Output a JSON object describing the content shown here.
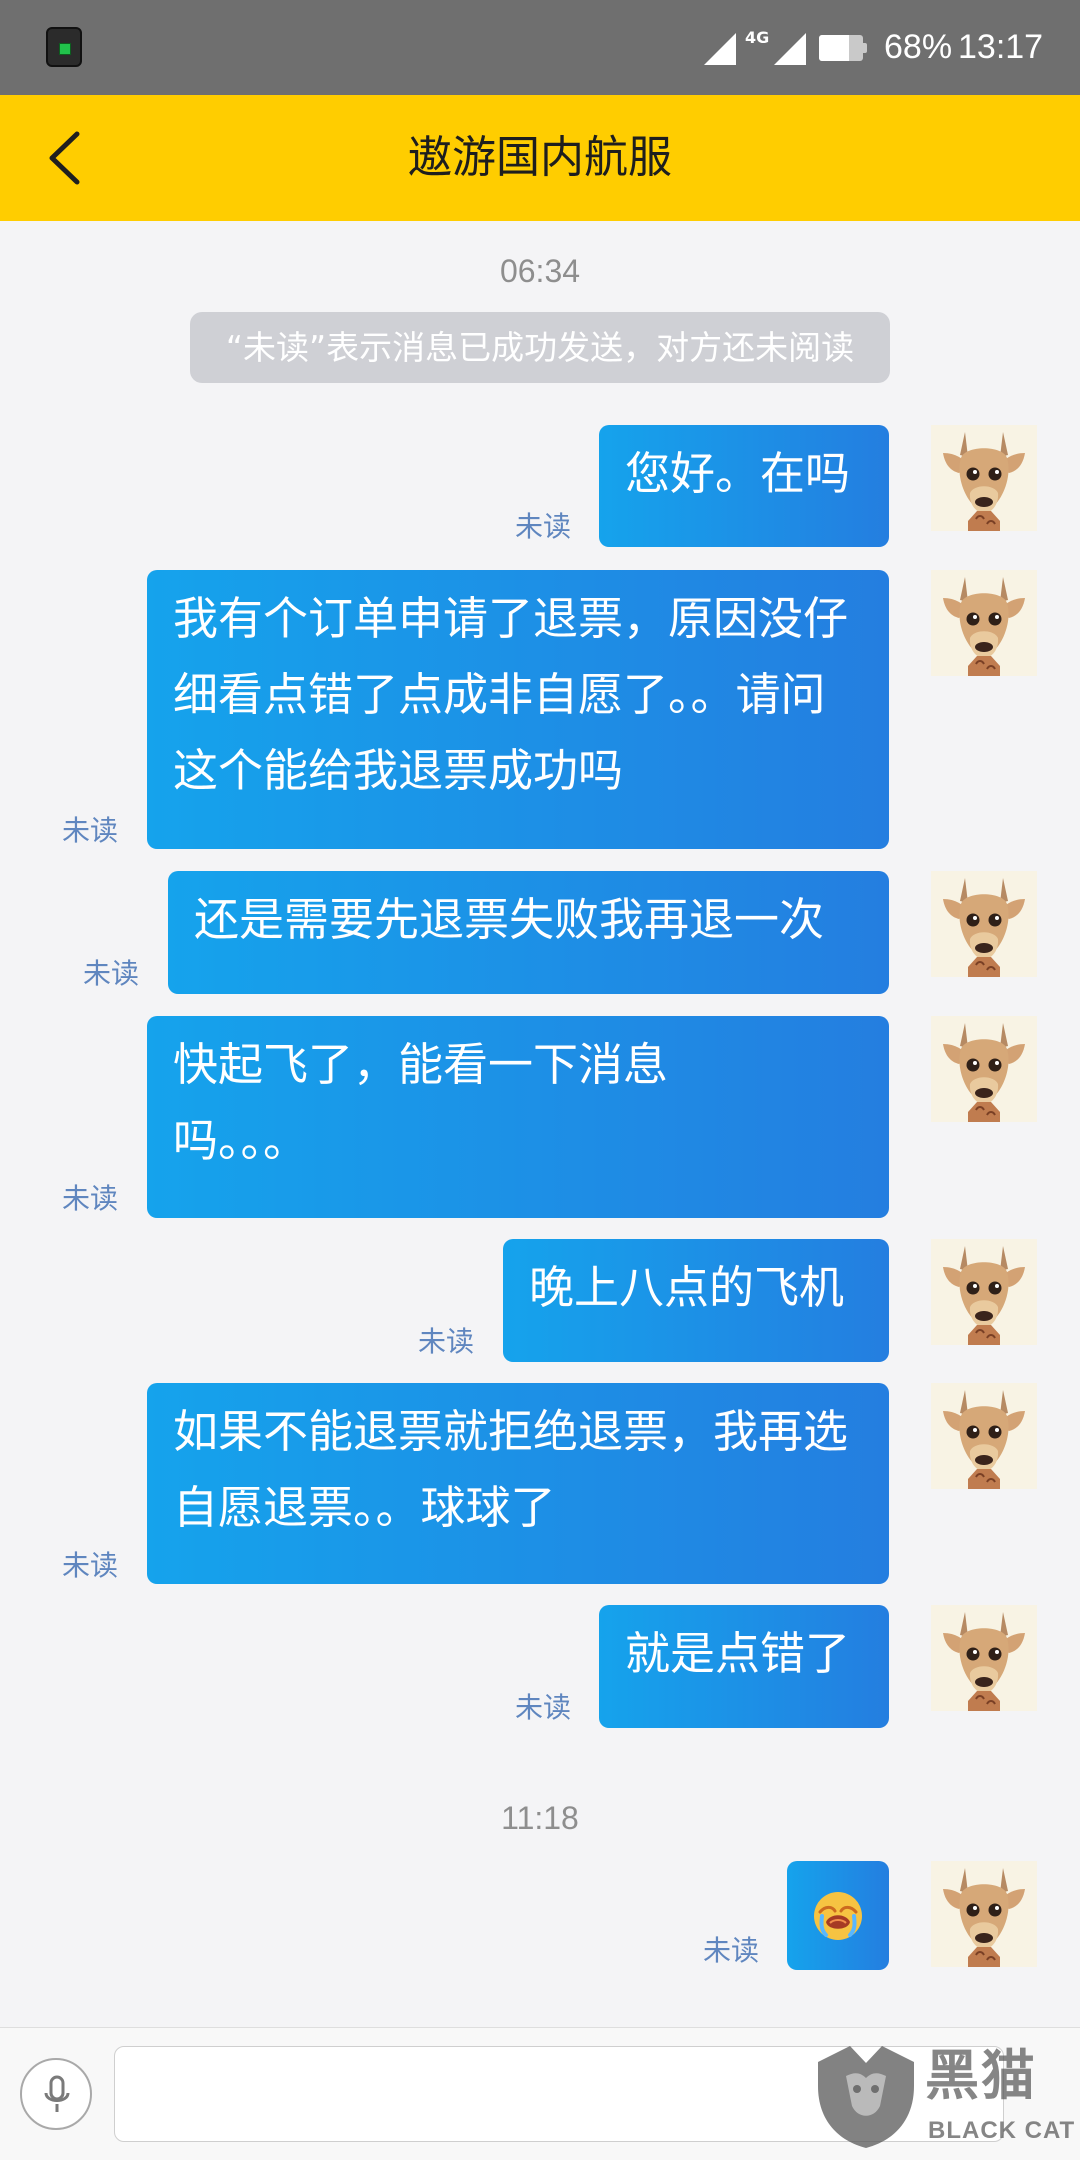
{
  "status_bar": {
    "network": "4G",
    "battery_percent": "68%",
    "time": "13:17",
    "icons": [
      "app-icon",
      "signal-icon",
      "battery-icon"
    ]
  },
  "header": {
    "title": "遨游国内航服",
    "back_icon": "chevron-left-icon"
  },
  "conversation": {
    "timestamps": [
      "06:34",
      "11:18"
    ],
    "notice": "“未读”表示消息已成功发送，对方还未阅读",
    "messages": [
      {
        "text": "您好。在吗",
        "status": "未读"
      },
      {
        "text": "我有个订单申请了退票，原因没仔细看点错了点成非自愿了。。请问这个能给我退票成功吗",
        "status": "未读"
      },
      {
        "text": "还是需要先退票失败我再退一次",
        "status": "未读"
      },
      {
        "text": "快起飞了，能看一下消息吗。。。",
        "status": "未读"
      },
      {
        "text": "晚上八点的飞机",
        "status": "未读"
      },
      {
        "text": "如果不能退票就拒绝退票，我再选自愿退票。。球球了",
        "status": "未读"
      },
      {
        "text": "就是点错了",
        "status": "未读"
      },
      {
        "text": "",
        "status": "未读",
        "emoji": "crying-face-icon"
      }
    ]
  },
  "input": {
    "value": "",
    "placeholder": "",
    "mic_icon": "microphone-icon"
  },
  "watermark": {
    "wordmark": "黑猫",
    "subtitle": "BLACK CAT"
  },
  "colors": {
    "header_bg": "#ffcd00",
    "bubble_start": "#15a3ec",
    "bubble_end": "#247ee0",
    "status_text": "#5f86bf"
  }
}
